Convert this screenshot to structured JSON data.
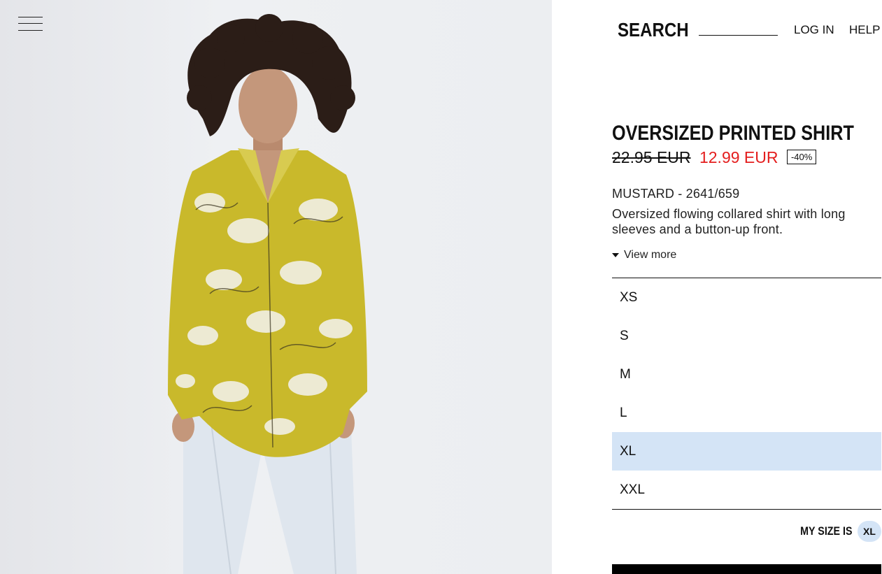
{
  "header": {
    "search_label": "SEARCH",
    "search_placeholder": "",
    "login_label": "LOG IN",
    "help_label": "HELP"
  },
  "product": {
    "title": "OVERSIZED PRINTED SHIRT",
    "old_price": "22.95 EUR",
    "new_price": "12.99 EUR",
    "discount": "-40%",
    "color_ref": "MUSTARD - 2641/659",
    "description": "Oversized flowing collared shirt with long sleeves and a button-up front.",
    "view_more": "View more"
  },
  "sizes": {
    "items": [
      "XS",
      "S",
      "M",
      "L",
      "XL",
      "XXL"
    ],
    "selected": "XL"
  },
  "my_size": {
    "label": "MY SIZE IS",
    "value": "XL"
  },
  "colors": {
    "sale_price": "#e41e1e",
    "selected_size_bg": "#d4e4f6",
    "shirt": "#c9b92b",
    "text": "#111111"
  },
  "icons": {
    "menu": "hamburger-menu-icon",
    "view_more": "caret-down-icon"
  }
}
